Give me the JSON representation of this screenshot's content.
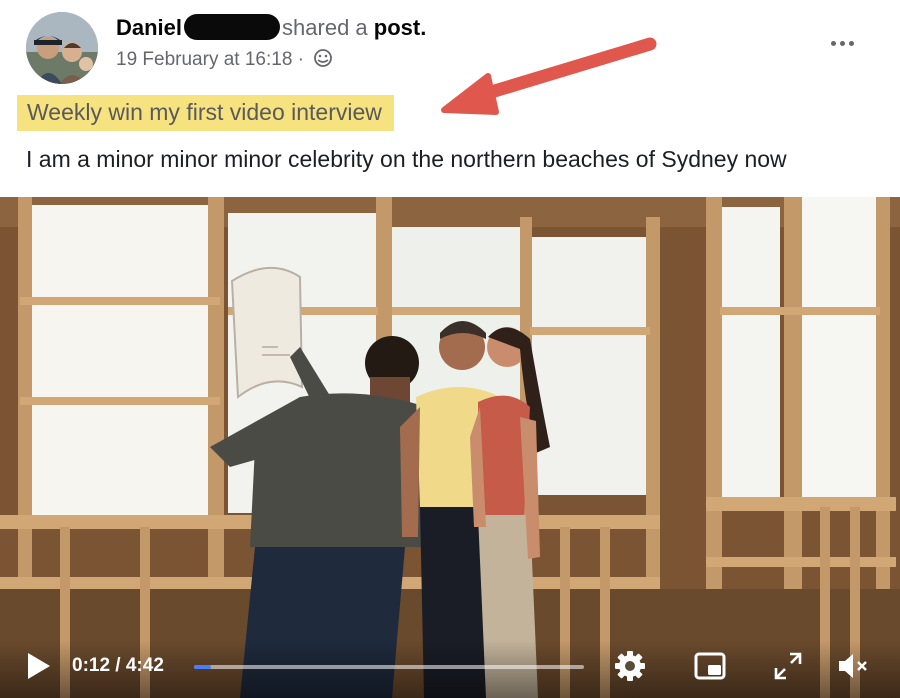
{
  "post": {
    "author_name": "Daniel",
    "shared_text": "shared a",
    "post_word": "post.",
    "timestamp": "19 February at 16:18 ·",
    "privacy_icon": "globe-icon",
    "more_icon": "more-options-icon"
  },
  "annotation": {
    "highlighted_text": "Weekly win my first video interview",
    "highlight_color": "#f6e27f",
    "arrow_color": "#e0584d"
  },
  "body": {
    "text": "I am a minor minor minor celebrity on the northern beaches of Sydney now"
  },
  "video": {
    "time": "0:12 / 4:42",
    "progress": 0.0426,
    "progress_color": "#4a7dfa",
    "controls": [
      "play-icon",
      "settings-icon",
      "picture-in-picture-icon",
      "fullscreen-icon",
      "mute-icon"
    ]
  }
}
